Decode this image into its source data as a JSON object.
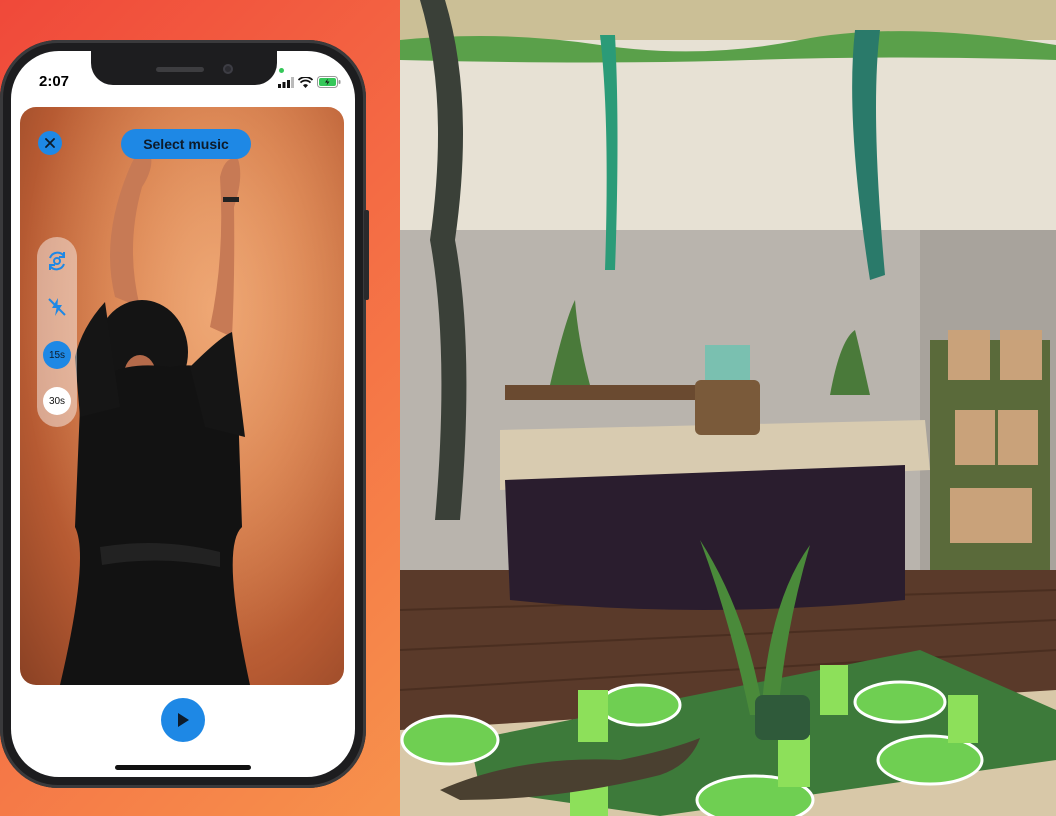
{
  "status_bar": {
    "time": "2:07"
  },
  "camera_screen": {
    "select_music_label": "Select music",
    "durations": [
      {
        "label": "15s",
        "selected": true
      },
      {
        "label": "30s",
        "selected": false
      }
    ],
    "icons": {
      "close": "close-icon",
      "flip_camera": "flip-camera-icon",
      "flash": "flash-off-icon",
      "play": "play-icon"
    }
  },
  "colors": {
    "accent": "#1e88e5",
    "background_gradient_start": "#f0493a",
    "background_gradient_end": "#f7924c"
  }
}
